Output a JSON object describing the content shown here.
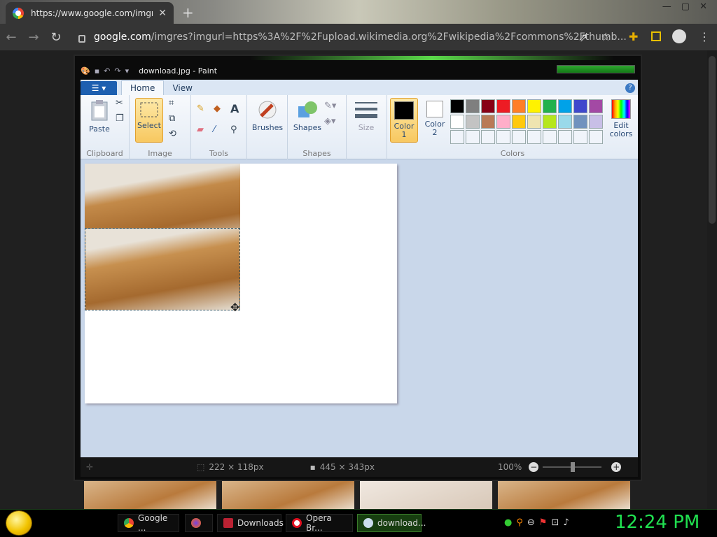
{
  "browser": {
    "tab_title": "https://www.google.com/imgres",
    "tab_close": "✕",
    "new_tab": "+",
    "url_domain": "google.com",
    "url_path": "/imgres?imgurl=https%3A%2F%2Fupload.wikimedia.org%2Fwikipedia%2Fcommons%2Fthumb...",
    "window_controls": [
      "—",
      "▢",
      "✕"
    ]
  },
  "paint": {
    "title": "download.jpg - Paint",
    "tabs": [
      "Home",
      "View"
    ],
    "help": "?",
    "groups": {
      "clipboard": "Clipboard",
      "image": "Image",
      "tools": "Tools",
      "shapes": "Shapes",
      "colors": "Colors"
    },
    "buttons": {
      "paste": "Paste",
      "select": "Select",
      "brushes": "Brushes",
      "shapes": "Shapes",
      "size": "Size",
      "color1": "Color\n1",
      "color2": "Color\n2",
      "edit_colors": "Edit\ncolors"
    },
    "palette": [
      "#000000",
      "#7f7f7f",
      "#880015",
      "#ed1c24",
      "#ff7f27",
      "#fff200",
      "#22b14c",
      "#00a2e8",
      "#3f48cc",
      "#a349a4",
      "#ffffff",
      "#c3c3c3",
      "#b97a57",
      "#ffaec9",
      "#ffc90e",
      "#efe4b0",
      "#b5e61d",
      "#99d9ea",
      "#7092be",
      "#c8bfe7",
      "#f0f4fa",
      "#f0f4fa",
      "#f0f4fa",
      "#f0f4fa",
      "#f0f4fa",
      "#f0f4fa",
      "#f0f4fa",
      "#f0f4fa",
      "#f0f4fa",
      "#f0f4fa"
    ],
    "status": {
      "selection_size": "222 × 118px",
      "image_size": "445 × 343px",
      "zoom": "100%"
    }
  },
  "taskbar": {
    "items": [
      "Google ...",
      "",
      "Downloads",
      "Opera Br...",
      "download..."
    ],
    "clock": "12:24 PM"
  }
}
